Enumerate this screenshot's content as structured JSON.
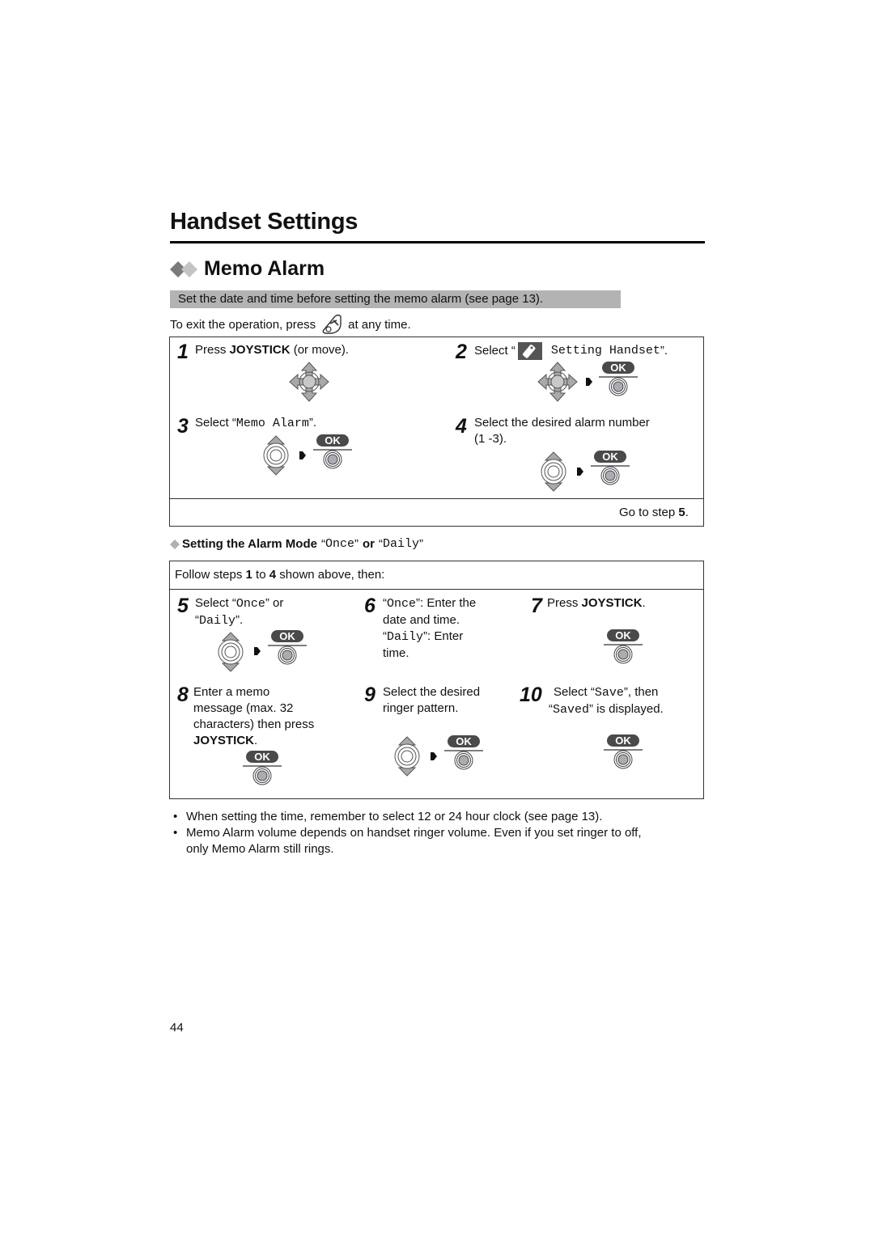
{
  "header": {
    "title": "Handset Settings"
  },
  "section": {
    "title": "Memo Alarm",
    "note": "Set the date and time before setting the memo alarm (see page 13).",
    "exit_prefix": "To exit the operation, press",
    "exit_suffix": "at any time.",
    "exit_icon": "off-key-icon"
  },
  "steps_top": [
    {
      "num": "1",
      "pre": "Press ",
      "bold": "JOYSTICK",
      "post": " (or move)."
    },
    {
      "num": "2",
      "pre": "Select “",
      "mono": "Setting Handset",
      "post": "”.",
      "icon": "handset-setting-icon"
    },
    {
      "num": "3",
      "pre": "Select “",
      "mono": "Memo Alarm",
      "post": "”."
    },
    {
      "num": "4",
      "line1": "Select the desired alarm number",
      "line2": "(1 -3)."
    }
  ],
  "goto": {
    "prefix": "Go to step ",
    "step": "5",
    "suffix": "."
  },
  "subsection": {
    "prefix": "Setting the Alarm Mode",
    "opt1": "Once",
    "or": "or",
    "opt2": "Daily"
  },
  "follow": {
    "pre": "Follow steps ",
    "a": "1",
    "mid": " to ",
    "b": "4",
    "post": " shown above, then:"
  },
  "steps_bottom": [
    {
      "num": "5",
      "l1_pre": "Select “",
      "l1_mono": "Once",
      "l1_post": "” or",
      "l2_pre": "“",
      "l2_mono": "Daily",
      "l2_post": "”."
    },
    {
      "num": "6",
      "l1_pre": "“",
      "l1_mono": "Once",
      "l1_post": "”: Enter the",
      "l2": "date and time.",
      "l3_pre": "“",
      "l3_mono": "Daily",
      "l3_post": "”: Enter",
      "l4": "time."
    },
    {
      "num": "7",
      "pre": "Press ",
      "bold": "JOYSTICK",
      "post": "."
    },
    {
      "num": "8",
      "l1": "Enter a memo",
      "l2": "message (max. 32",
      "l3": "characters) then press",
      "bold": "JOYSTICK",
      "post": "."
    },
    {
      "num": "9",
      "l1": "Select the desired",
      "l2": "ringer pattern."
    },
    {
      "num": "10",
      "l1_pre": "Select “",
      "l1_mono": "Save",
      "l1_post": "”, then",
      "l2_pre": "“",
      "l2_mono": "Saved",
      "l2_post": "” is displayed."
    }
  ],
  "ok_label": "OK",
  "notes": [
    "When setting the time, remember to select 12 or 24 hour clock (see page 13).",
    "Memo Alarm volume depends on handset ringer volume. Even if you set ringer to off, only Memo Alarm still rings."
  ],
  "notes_split": {
    "line2a": "Memo Alarm volume depends on handset ringer volume. Even if you set ringer to off,",
    "line2b": "only Memo Alarm still rings."
  },
  "page_number": "44",
  "colors": {
    "note_bg": "#b3b3b3",
    "diamond_dark": "#7a7a7a",
    "diamond_light": "#c4c4c4",
    "ok_bg": "#4a4a4a",
    "joystick_fill": "#a9a9a9"
  }
}
